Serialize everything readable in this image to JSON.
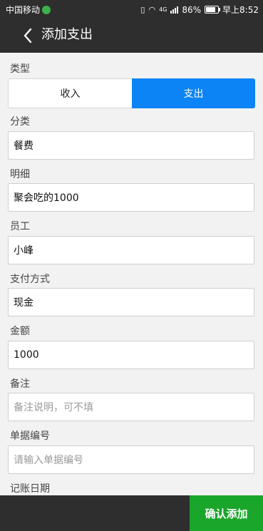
{
  "status_bar": {
    "carrier": "中国移动",
    "network": "4G",
    "battery": "86%",
    "time": "早上8:52"
  },
  "header": {
    "title": "添加支出"
  },
  "form": {
    "type": {
      "label": "类型",
      "options": [
        "收入",
        "支出"
      ],
      "selected": "支出"
    },
    "category": {
      "label": "分类",
      "value": "餐费"
    },
    "detail": {
      "label": "明细",
      "value": "聚会吃的1000"
    },
    "employee": {
      "label": "员工",
      "value": "小峰"
    },
    "payment_method": {
      "label": "支付方式",
      "value": "现金"
    },
    "amount": {
      "label": "金额",
      "value": "1000"
    },
    "note": {
      "label": "备注",
      "placeholder": "备注说明，可不填"
    },
    "receipt_no": {
      "label": "单据编号",
      "placeholder": "请输入单据编号"
    },
    "date": {
      "label": "记账日期"
    }
  },
  "footer": {
    "confirm_label": "确认添加"
  },
  "colors": {
    "header_bg": "#2e2e2e",
    "selected_segment": "#0d84f5",
    "confirm_button": "#1aa52b"
  }
}
